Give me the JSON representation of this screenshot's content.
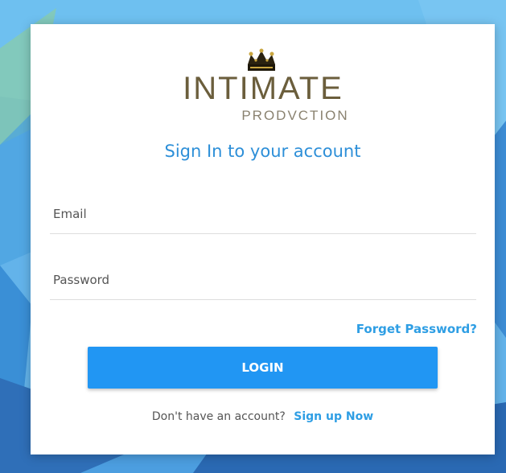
{
  "logo": {
    "brand": "INTIMATE",
    "sub": "PRODVCTION",
    "icon": "crown-icon"
  },
  "signin": {
    "title": "Sign In to your account"
  },
  "form": {
    "email_placeholder": "Email",
    "password_placeholder": "Password",
    "forget_label": "Forget Password?",
    "login_label": "LOGIN"
  },
  "signup": {
    "prompt": "Don't have an account?",
    "link_label": "Sign up Now"
  },
  "colors": {
    "accent": "#2196f3",
    "link": "#2e9ee4",
    "title": "#2d8fd8",
    "brand": "#6b5e3c"
  }
}
